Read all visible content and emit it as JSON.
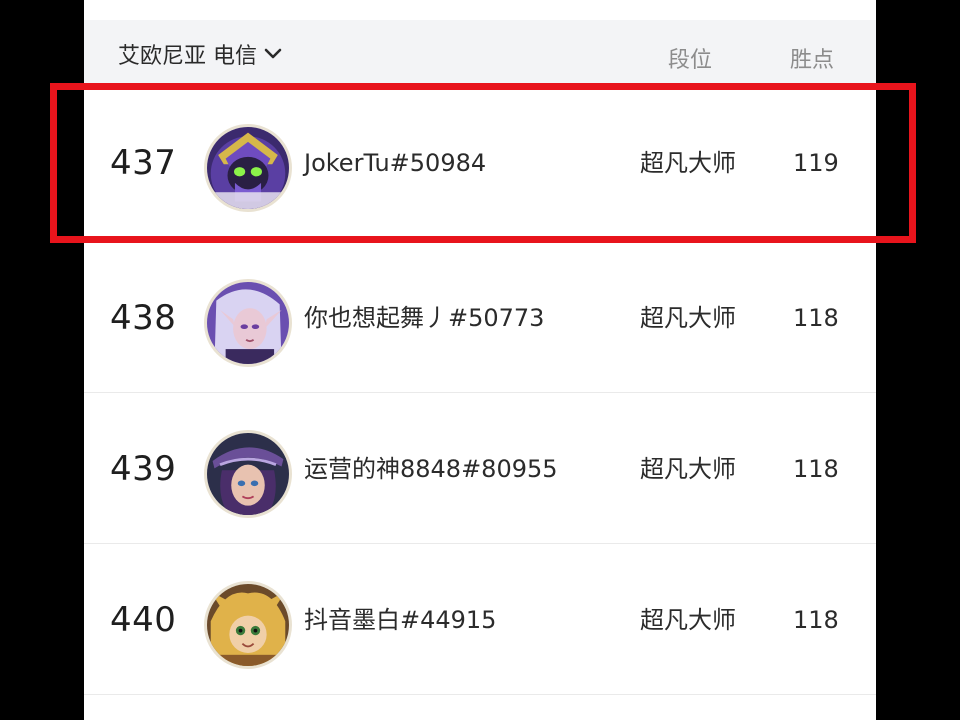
{
  "header": {
    "region_label": "艾欧尼亚 电信",
    "col_rank": "段位",
    "col_points": "胜点"
  },
  "rows": [
    {
      "rank_number": "437",
      "player_name": "JokerTu#50984",
      "tier": "超凡大师",
      "points": "119",
      "avatar": "purple-masked-champion-avatar"
    },
    {
      "rank_number": "438",
      "player_name": "你也想起舞丿#50773",
      "tier": "超凡大师",
      "points": "118",
      "avatar": "white-haired-elf-champion-avatar"
    },
    {
      "rank_number": "439",
      "player_name": "运营的神8848#80955",
      "tier": "超凡大师",
      "points": "118",
      "avatar": "purple-hat-champion-avatar"
    },
    {
      "rank_number": "440",
      "player_name": "抖音墨白#44915",
      "tier": "超凡大师",
      "points": "118",
      "avatar": "blonde-yordle-champion-avatar"
    }
  ],
  "colors": {
    "highlight": "#e8141c",
    "header_bg": "#f3f4f6"
  }
}
